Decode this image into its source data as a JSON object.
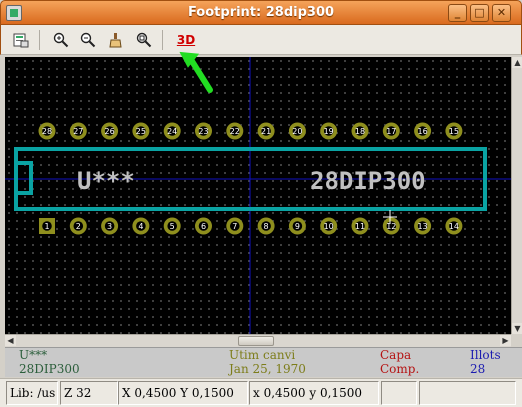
{
  "window": {
    "title": "Footprint: 28dip300"
  },
  "toolbar": {
    "items": [
      {
        "name": "read-footprint-icon"
      },
      {
        "name": "zoom-in-icon"
      },
      {
        "name": "zoom-out-icon"
      },
      {
        "name": "redraw-icon"
      },
      {
        "name": "zoom-fit-icon"
      },
      {
        "name": "3d-view-button",
        "label": "3D"
      }
    ]
  },
  "footprint": {
    "reference": "U***",
    "value": "28DIP300",
    "top_row_pins": [
      "28",
      "27",
      "26",
      "25",
      "24",
      "23",
      "22",
      "21",
      "20",
      "19",
      "18",
      "17",
      "16",
      "15"
    ],
    "bottom_row_pins": [
      "1",
      "2",
      "3",
      "4",
      "5",
      "6",
      "7",
      "8",
      "9",
      "10",
      "11",
      "12",
      "13",
      "14"
    ]
  },
  "info": {
    "ref": "U***",
    "name": "28DIP300",
    "edit_label": "Utim canvi",
    "edit_date": "Jan 25, 1970",
    "layer_label": "Capa",
    "layer_value": "Comp.",
    "islands_label": "Illots",
    "islands_value": "28"
  },
  "status": {
    "lib": "Lib: /us",
    "zoom": "Z 32",
    "abs": "X 0,4500  Y 0,1500",
    "rel": "x 0,4500  y 0,1500",
    "empty1": "",
    "empty2": ""
  },
  "colors": {
    "outline": "#0aa3a3",
    "pad": "#8f8f1e",
    "text": "#c0c0c0",
    "axis": "#1010c0",
    "arrow": "#22dd22"
  }
}
